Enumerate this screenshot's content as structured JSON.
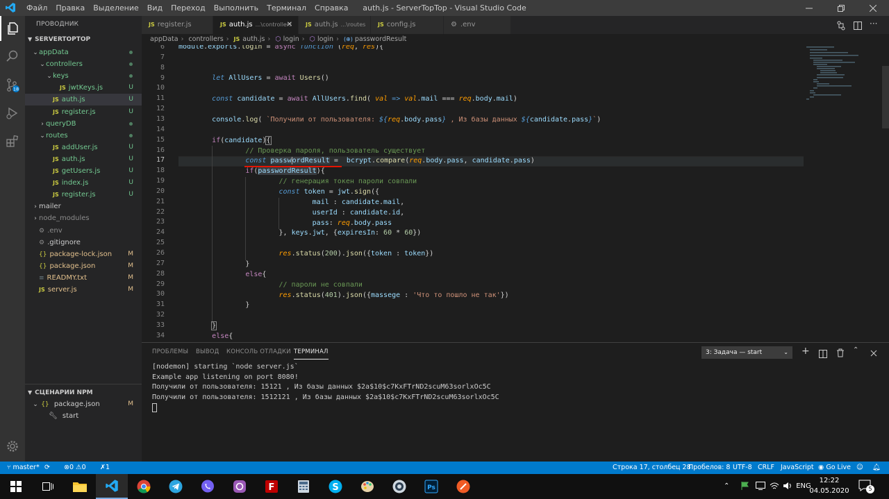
{
  "window": {
    "title": "auth.js - ServerTopTop - Visual Studio Code",
    "menu": [
      "Файл",
      "Правка",
      "Выделение",
      "Вид",
      "Переход",
      "Выполнить",
      "Терминал",
      "Справка"
    ]
  },
  "sidebar": {
    "header": "ПРОВОДНИК",
    "section": "SERVERTOPTOP",
    "tree": [
      {
        "label": "appData",
        "type": "folder",
        "open": true,
        "depth": 0,
        "dot": true
      },
      {
        "label": "controllers",
        "type": "folder",
        "open": true,
        "depth": 1,
        "dot": true
      },
      {
        "label": "keys",
        "type": "folder",
        "open": true,
        "depth": 2,
        "dot": true
      },
      {
        "label": "jwtKeys.js",
        "type": "js",
        "depth": 3,
        "badge": "U"
      },
      {
        "label": "auth.js",
        "type": "js",
        "depth": 2,
        "badge": "U",
        "selected": true
      },
      {
        "label": "register.js",
        "type": "js",
        "depth": 2,
        "badge": "U"
      },
      {
        "label": "queryDB",
        "type": "folder",
        "open": false,
        "depth": 1,
        "dot": true
      },
      {
        "label": "routes",
        "type": "folder",
        "open": true,
        "depth": 1,
        "dot": true
      },
      {
        "label": "addUser.js",
        "type": "js",
        "depth": 2,
        "badge": "U"
      },
      {
        "label": "auth.js",
        "type": "js",
        "depth": 2,
        "badge": "U"
      },
      {
        "label": "getUsers.js",
        "type": "js",
        "depth": 2,
        "badge": "U"
      },
      {
        "label": "index.js",
        "type": "js",
        "depth": 2,
        "badge": "U"
      },
      {
        "label": "register.js",
        "type": "js",
        "depth": 2,
        "badge": "U"
      },
      {
        "label": "mailer",
        "type": "folder",
        "open": false,
        "depth": 0
      },
      {
        "label": "node_modules",
        "type": "folder",
        "open": false,
        "depth": 0,
        "dim": true
      },
      {
        "label": ".env",
        "type": "gear",
        "depth": 0,
        "dim": true
      },
      {
        "label": ".gitignore",
        "type": "gear",
        "depth": 0
      },
      {
        "label": "package-lock.json",
        "type": "json",
        "depth": 0,
        "badge": "M"
      },
      {
        "label": "package.json",
        "type": "json",
        "depth": 0,
        "badge": "M"
      },
      {
        "label": "READMY.txt",
        "type": "txt",
        "depth": 0,
        "badge": "M"
      },
      {
        "label": "server.js",
        "type": "js",
        "depth": 0,
        "badge": "M"
      }
    ],
    "npm_section": "СЦЕНАРИИ NPM",
    "npm": [
      {
        "label": "package.json",
        "badge": "M"
      },
      {
        "label": "start"
      }
    ]
  },
  "tabs": [
    {
      "label": "register.js",
      "desc": ""
    },
    {
      "label": "auth.js",
      "desc": "...\\controllers",
      "active": true
    },
    {
      "label": "auth.js",
      "desc": "...\\routes"
    },
    {
      "label": "config.js",
      "desc": ""
    },
    {
      "label": ".env",
      "desc": ""
    }
  ],
  "breadcrumb": [
    "appData",
    "controllers",
    "auth.js",
    "login",
    "login",
    "passwordResult"
  ],
  "editor": {
    "lines": [
      6,
      7,
      8,
      9,
      10,
      11,
      12,
      13,
      14,
      15,
      16,
      17,
      18,
      19,
      20,
      21,
      22,
      23,
      24,
      25,
      26,
      27,
      28,
      29,
      30,
      31,
      32,
      33,
      34
    ],
    "current_line": 17
  },
  "panel": {
    "tabs": [
      "ПРОБЛЕМЫ",
      "ВЫВОД",
      "КОНСОЛЬ ОТЛАДКИ",
      "ТЕРМИНАЛ"
    ],
    "terminal_select": "3: Задача — start",
    "terminal_lines": [
      "[nodemon] starting `node server.js`",
      "Example app listening on port 8080!",
      "Получили от пользователя: 15121 , Из базы данных $2a$10$c7KxFTrND2scuM63sorlxOc5C",
      "Получили от пользователя: 1512121 , Из базы данных $2a$10$c7KxFTrND2scuM63sorlxOc5C"
    ]
  },
  "status": {
    "branch": "master*",
    "errors": "0",
    "warnings": "0",
    "ports": "1",
    "position": "Строка 17, столбец 28",
    "spaces": "Пробелов: 8",
    "encoding": "UTF-8",
    "eol": "CRLF",
    "language": "JavaScript",
    "golive": "Go Live"
  },
  "taskbar": {
    "lang": "ENG",
    "time": "12:22",
    "date": "04.05.2020",
    "notif_count": "5"
  },
  "colors": {
    "accent": "#007acc",
    "keyword": "#569cd6",
    "control": "#c586c0",
    "function": "#dcdcaa",
    "string": "#ce9178",
    "comment": "#6a9955"
  }
}
